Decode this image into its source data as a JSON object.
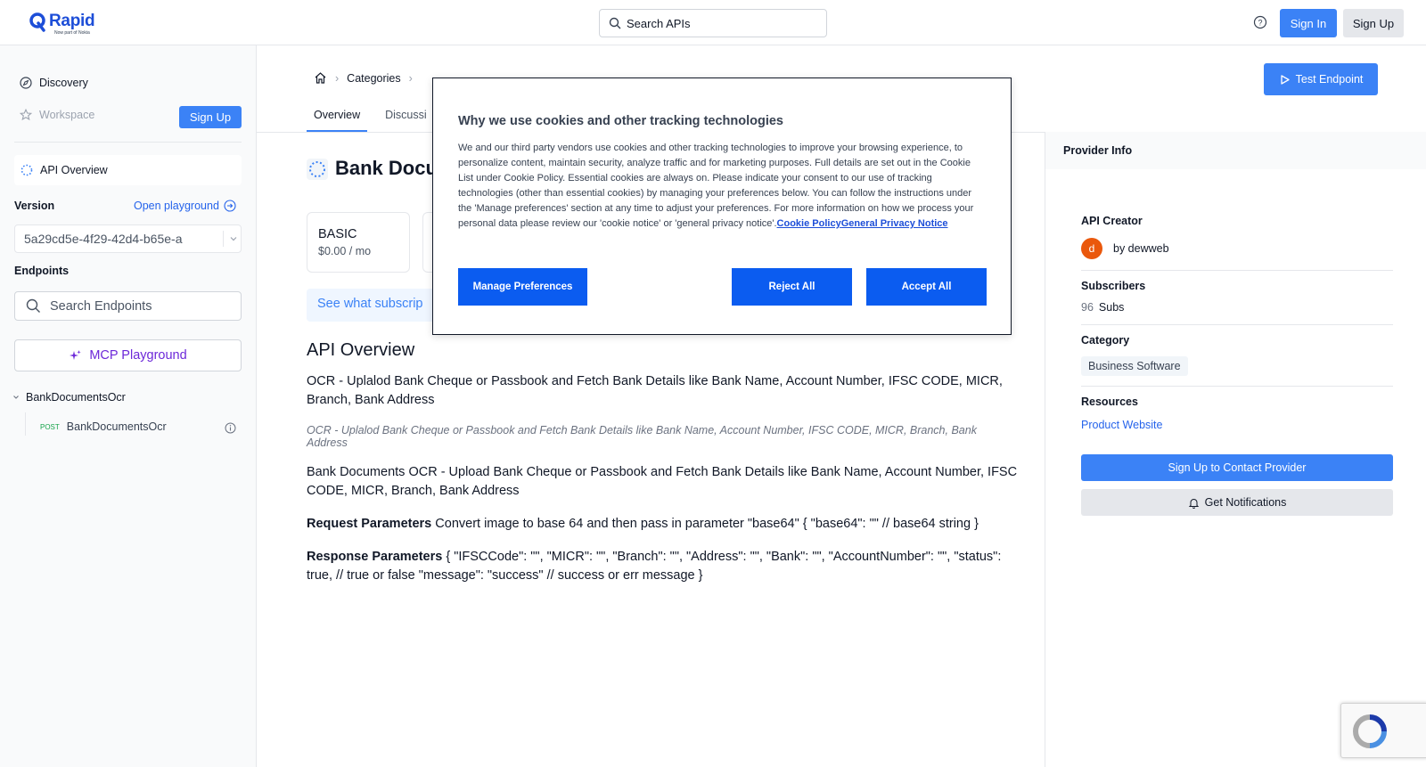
{
  "brand": {
    "name": "Rapid",
    "tagline": "Now part of Nokia",
    "color": "#1d4ed8"
  },
  "topbar": {
    "search_placeholder": "Search APIs",
    "sign_in": "Sign In",
    "sign_up": "Sign Up"
  },
  "sidebar": {
    "discovery": "Discovery",
    "workspace": "Workspace",
    "sign_up": "Sign Up",
    "api_overview": "API Overview",
    "version_label": "Version",
    "open_playground": "Open playground",
    "version_value": "5a29cd5e-4f29-42d4-b65e-a",
    "endpoints_label": "Endpoints",
    "search_endpoints_placeholder": "Search Endpoints",
    "mcp_playground": "MCP Playground",
    "group": "BankDocumentsOcr",
    "endpoints": [
      {
        "method": "POST",
        "name": "BankDocumentsOcr"
      }
    ]
  },
  "breadcrumb": {
    "categories": "Categories"
  },
  "tabs": [
    {
      "label": "Overview",
      "active": true
    },
    {
      "label": "Discussi",
      "active": false
    }
  ],
  "test_endpoint": "Test Endpoint",
  "main": {
    "title": "Bank Docu",
    "plans": [
      {
        "name": "BASIC",
        "price": "$0.00 / mo"
      }
    ],
    "see_what": "See what subscrip",
    "section_heading": "API Overview",
    "paragraph1": "OCR - Uplalod Bank Cheque or Passbook and Fetch Bank Details like Bank Name, Account Number, IFSC CODE, MICR, Branch, Bank Address",
    "paragraph_italic": "OCR - Uplalod Bank Cheque or Passbook and Fetch Bank Details like Bank Name, Account Number, IFSC CODE, MICR, Branch, Bank Address",
    "paragraph2": "Bank Documents OCR - Upload Bank Cheque or Passbook and Fetch Bank Details like Bank Name, Account Number, IFSC CODE, MICR, Branch, Bank Address",
    "request_label": "Request Parameters",
    "request_text": " Convert image to base 64 and then pass in parameter \"base64\" { \"base64\": \"\" // base64 string }",
    "response_label": "Response Parameters",
    "response_text": " { \"IFSCCode\": \"\", \"MICR\": \"\", \"Branch\": \"\", \"Address\": \"\", \"Bank\": \"\", \"AccountNumber\": \"\", \"status\": true, // true or false \"message\": \"success\" // success or err message }"
  },
  "provider": {
    "header": "Provider Info",
    "creator_label": "API Creator",
    "creator_initial": "d",
    "creator_by": "by dewweb",
    "subscribers_label": "Subscribers",
    "subscribers_count": "96",
    "subscribers_unit": "Subs",
    "category_label": "Category",
    "category_value": "Business Software",
    "resources_label": "Resources",
    "resources_link": "Product Website",
    "contact_button": "Sign Up to Contact Provider",
    "notifications_button": "Get Notifications"
  },
  "cookie": {
    "title": "Why we use cookies and other tracking technologies",
    "body": "We and our third party vendors use cookies and other tracking technologies to improve your browsing experience, to personalize content, maintain security, analyze traffic and for marketing purposes. Full details are set out in the Cookie List under Cookie Policy. Essential cookies are always on. Please indicate your consent to our use of tracking technologies (other than essential cookies) by managing your preferences below. You can follow the instructions under the 'Manage preferences' section at any time to adjust your preferences. For more information on how we process your personal data please review our 'cookie notice' or 'general privacy notice'.",
    "link1": "Cookie Policy",
    "link2": "General Privacy Notice",
    "manage": "Manage Preferences",
    "reject": "Reject All",
    "accept": "Accept All",
    "button_color": "#0b5cf0"
  }
}
